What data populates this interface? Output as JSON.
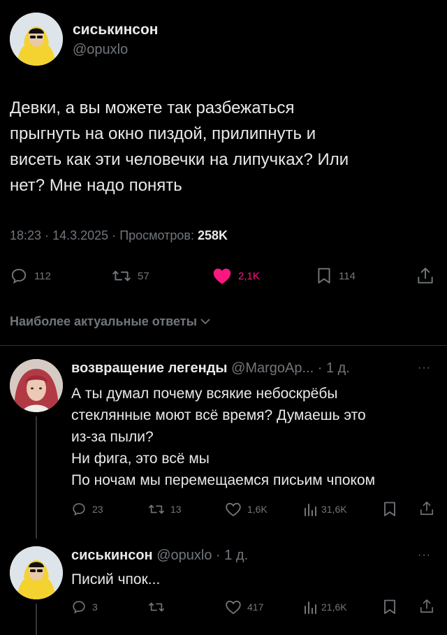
{
  "main_post": {
    "display_name": "сиськинсон",
    "handle": "@opuxlo",
    "text": "Девки, а вы можете так разбежаться\nпрыгнуть на окно пиздой, прилипнуть и\nвисеть как эти человечки на липучках? Или\nнет? Мне надо понять",
    "time": "18:23",
    "date": "14.3.2025",
    "views_label": "Просмотров:",
    "views_count": "258K",
    "replies": "112",
    "reposts": "57",
    "likes": "2,1K",
    "bookmarks": "114"
  },
  "sort_label": "Наиболее актуальные ответы",
  "replies": [
    {
      "display_name": "возвращение легенды",
      "handle": "@MargoAp...",
      "age": "1 д.",
      "text": "А ты думал почему всякие небоскрёбы\nстеклянные моют всё время? Думаешь это\nиз-за пыли?\nНи фига, это всё мы\nПо ночам мы перемещаемся письим чпоком",
      "replies": "23",
      "reposts": "13",
      "likes": "1,6K",
      "views": "31,6K"
    },
    {
      "display_name": "сиськинсон",
      "handle": "@opuxlo",
      "age": "1 д.",
      "text": "Писий чпок...",
      "replies": "3",
      "reposts": "",
      "likes": "417",
      "views": "21,6K"
    }
  ],
  "separator": "·",
  "more_glyph": "···",
  "colors": {
    "like_active": "#f91880",
    "secondary": "#71767b",
    "avatar_yellow": "#f4d331"
  }
}
